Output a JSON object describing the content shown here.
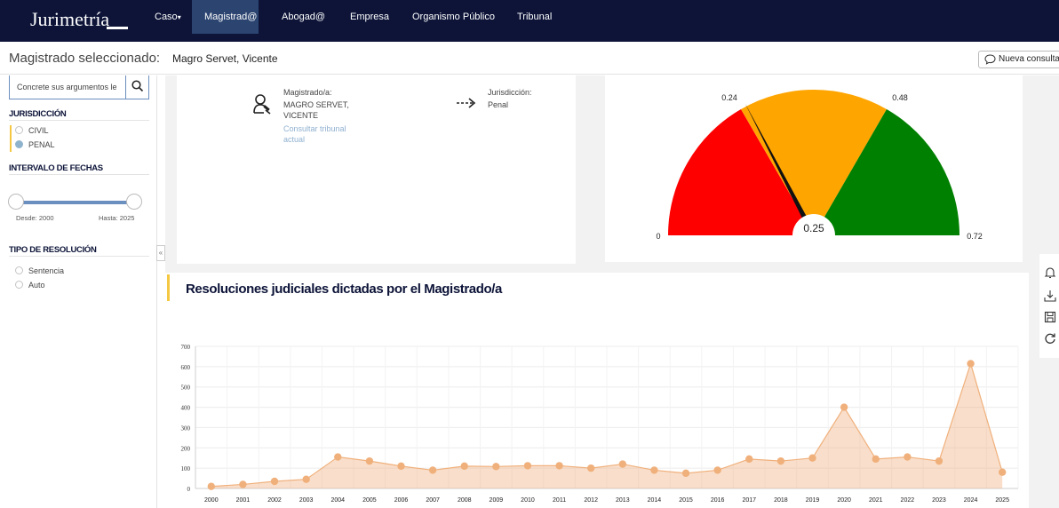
{
  "app": {
    "logo": "Jurimetría"
  },
  "nav": {
    "items": [
      {
        "label": "Caso",
        "active": false,
        "dropdown": true
      },
      {
        "label": "Magistrad@",
        "active": true
      },
      {
        "label": "Abogad@",
        "active": false
      },
      {
        "label": "Empresa",
        "active": false
      },
      {
        "label": "Organismo Público",
        "active": false
      },
      {
        "label": "Tribunal",
        "active": false
      }
    ],
    "caret": "▾"
  },
  "header": {
    "title": "Magistrado seleccionado:",
    "selected_name": "Magro Servet, Vicente",
    "new_query_label": "Nueva consulta"
  },
  "sidebar": {
    "search_placeholder": "Concrete sus argumentos le",
    "jurisdiccion": {
      "title": "JURISDICCIÓN",
      "options": [
        {
          "label": "CIVIL",
          "selected": false
        },
        {
          "label": "PENAL",
          "selected": true
        }
      ]
    },
    "intervalo": {
      "title": "INTERVALO DE FECHAS",
      "desde": "Desde: 2000",
      "hasta": "Hasta: 2025"
    },
    "tipo": {
      "title": "TIPO DE RESOLUCIÓN",
      "options": [
        {
          "label": "Sentencia",
          "selected": false
        },
        {
          "label": "Auto",
          "selected": false
        }
      ]
    },
    "collapse_glyph": "«"
  },
  "info_card": {
    "magistrado_label": "Magistrado/a:",
    "magistrado_name_1": "MAGRO SERVET,",
    "magistrado_name_2": "VICENTE",
    "tribunal_link_1": "Consultar tribunal",
    "tribunal_link_2": "actual",
    "jurisdiccion_label": "Jurisdicción:",
    "jurisdiccion_value": "Penal"
  },
  "gauge": {
    "min_label": "0",
    "max_label": "0.72",
    "t1_label": "0.24",
    "t2_label": "0.48",
    "value_label": "0.25",
    "min": 0,
    "max": 0.72,
    "thresholds": [
      0.24,
      0.48
    ],
    "value": 0.25,
    "colors": {
      "low": "#ff0000",
      "mid": "#ffa500",
      "high": "#008000",
      "needle": "#111111"
    }
  },
  "chart_section": {
    "title": "Resoluciones judiciales dictadas por el Magistrado/a"
  },
  "chart_data": {
    "type": "area",
    "title": "Resoluciones judiciales dictadas por el Magistrado/a",
    "xlabel": "",
    "ylabel": "",
    "ylim": [
      0,
      700
    ],
    "yticks": [
      0,
      100,
      200,
      300,
      400,
      500,
      600,
      700
    ],
    "grid": true,
    "color": "#f0b07c",
    "categories": [
      "2000",
      "2001",
      "2002",
      "2003",
      "2004",
      "2005",
      "2006",
      "2007",
      "2008",
      "2009",
      "2010",
      "2011",
      "2012",
      "2013",
      "2014",
      "2015",
      "2016",
      "2017",
      "2018",
      "2019",
      "2020",
      "2021",
      "2022",
      "2023",
      "2024",
      "2025"
    ],
    "values": [
      10,
      20,
      35,
      45,
      155,
      135,
      110,
      90,
      110,
      108,
      112,
      112,
      100,
      120,
      90,
      75,
      90,
      145,
      135,
      150,
      400,
      145,
      155,
      135,
      615,
      80
    ]
  },
  "toolbar": {
    "icons": [
      "bell-icon",
      "download-icon",
      "save-icon",
      "refresh-icon"
    ]
  }
}
